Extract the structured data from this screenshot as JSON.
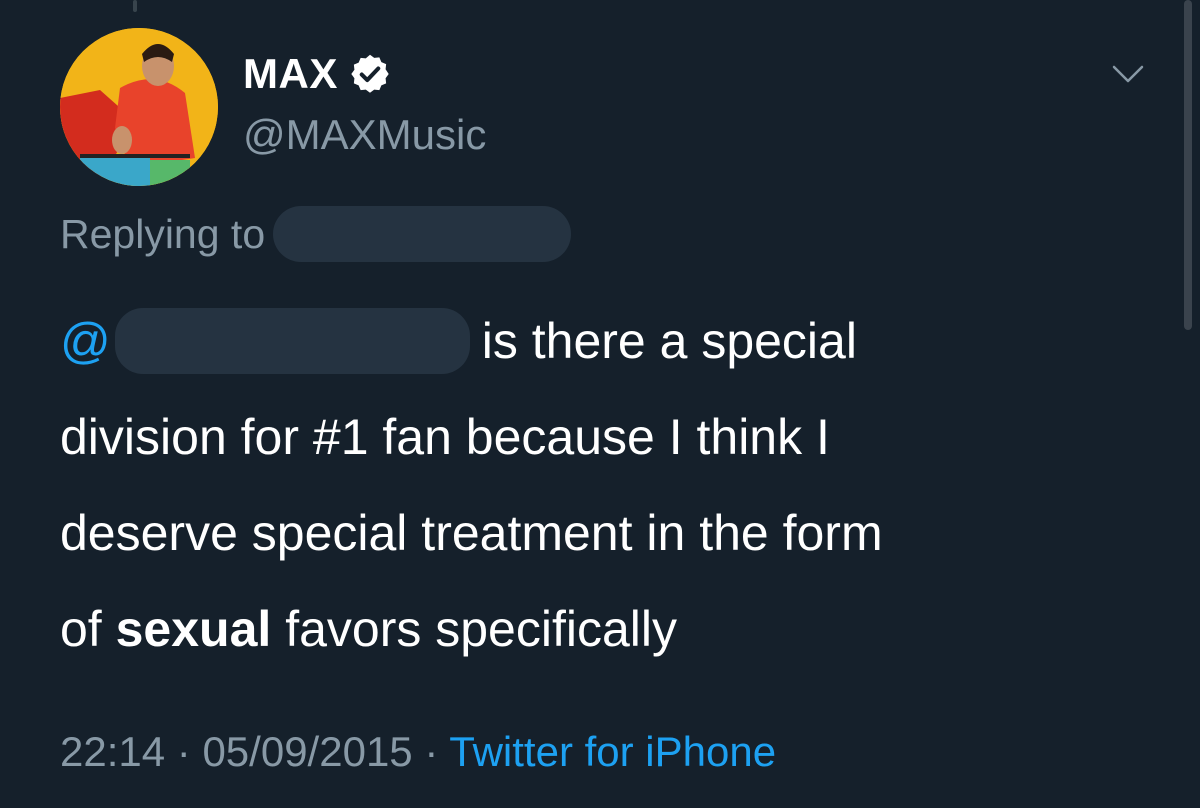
{
  "user": {
    "display_name": "MAX",
    "handle": "@MAXMusic",
    "verified": true
  },
  "reply": {
    "label": "Replying to"
  },
  "tweet": {
    "mention_prefix": "@",
    "line1": "is there a special",
    "line2": "division for #1 fan because I think I",
    "line3": "deserve special treatment in the form",
    "line4_start": "of",
    "line4_bold": "sexual",
    "line4_end": "favors specifically"
  },
  "meta": {
    "time": "22:14",
    "separator": "·",
    "date": "05/09/2015",
    "source": "Twitter for iPhone"
  },
  "colors": {
    "background": "#15202b",
    "text": "#ffffff",
    "secondary": "#8899a6",
    "accent": "#1da1f2",
    "redaction": "#253341"
  },
  "icons": {
    "verified": "verified-badge-icon",
    "menu": "chevron-down-icon"
  }
}
